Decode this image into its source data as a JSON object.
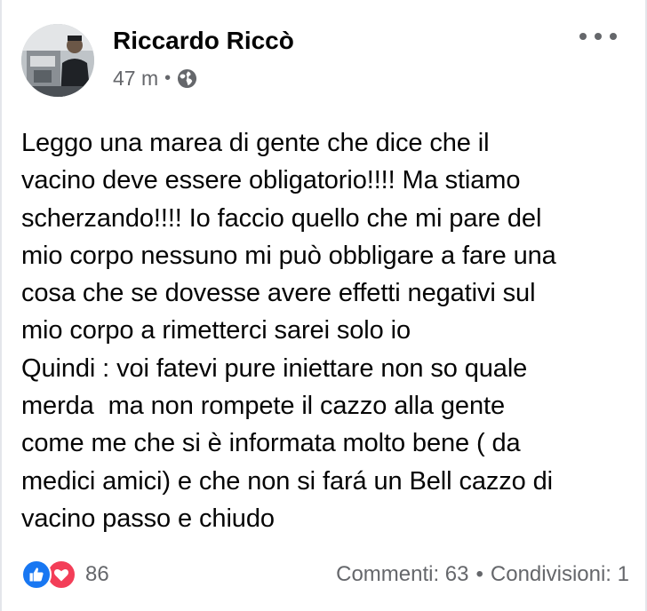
{
  "post": {
    "author": "Riccardo Riccò",
    "time": "47 m",
    "separator": "•",
    "globe_icon": "globe-icon",
    "more_icon": "more-horizontal-icon",
    "body_lines": [
      "Leggo una marea di gente che dice che il",
      "vacino deve essere obligatorio!!!! Ma stiamo",
      "scherzando!!!! Io faccio quello che mi pare del",
      "mio corpo nessuno mi può obbligare a fare una",
      "cosa che se dovesse avere effetti negativi sul",
      "mio corpo a rimetterci sarei solo io",
      "Quindi : voi fatevi pure iniettare non so quale",
      "merda  ma non rompete il cazzo alla gente",
      "come me che si è informata molto bene ( da",
      "medici amici) e che non si fará un Bell cazzo di",
      "vacino passo e chiudo"
    ]
  },
  "footer": {
    "reaction_icons": [
      "like-icon",
      "love-icon"
    ],
    "reaction_count": "86",
    "comments": "Commenti: 63",
    "separator": "•",
    "shares": "Condivisioni: 1"
  },
  "colors": {
    "like": "#1877f2",
    "love": "#f33e58",
    "secondary_text": "#65676b"
  }
}
